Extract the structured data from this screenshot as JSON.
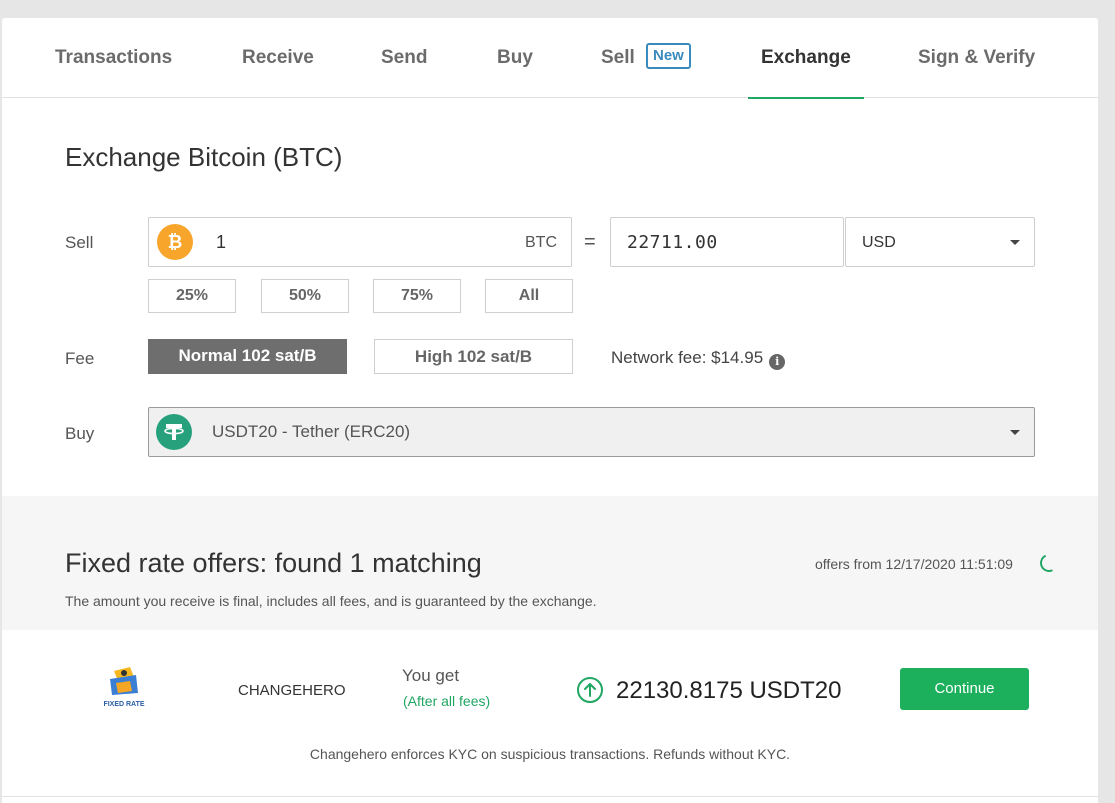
{
  "tabs": [
    {
      "label": "Transactions"
    },
    {
      "label": "Receive"
    },
    {
      "label": "Send"
    },
    {
      "label": "Buy"
    },
    {
      "label": "Sell",
      "badge": "New"
    },
    {
      "label": "Exchange",
      "active": true
    },
    {
      "label": "Sign & Verify"
    }
  ],
  "exchange": {
    "title": "Exchange Bitcoin (BTC)",
    "sell_label": "Sell",
    "sell_amount": "1",
    "sell_currency": "BTC",
    "equals": "=",
    "fiat_amount": "22711.00",
    "fiat_currency": "USD",
    "percent_buttons": [
      "25%",
      "50%",
      "75%",
      "All"
    ],
    "fee_label": "Fee",
    "fee_normal": "Normal 102 sat/B",
    "fee_high": "High 102 sat/B",
    "network_fee": "Network fee: $14.95",
    "buy_label": "Buy",
    "buy_asset": "USDT20 - Tether (ERC20)"
  },
  "offers": {
    "title": "Fixed rate offers: found 1 matching",
    "subtitle": "The amount you receive is final, includes all fees, and is guaranteed by the exchange.",
    "timestamp": "offers from 12/17/2020 11:51:09",
    "items": [
      {
        "logo_text": "FIXED RATE",
        "provider": "CHANGEHERO",
        "you_get_label": "You get",
        "after_fees": "(After all fees)",
        "amount": "22130.8175 USDT20",
        "action": "Continue",
        "note": "Changehero enforces KYC on suspicious transactions. Refunds without KYC."
      }
    ]
  },
  "colors": {
    "accent": "#21a663",
    "btc": "#f7a52b",
    "tether": "#26a17b",
    "badge": "#3a8bbd"
  }
}
